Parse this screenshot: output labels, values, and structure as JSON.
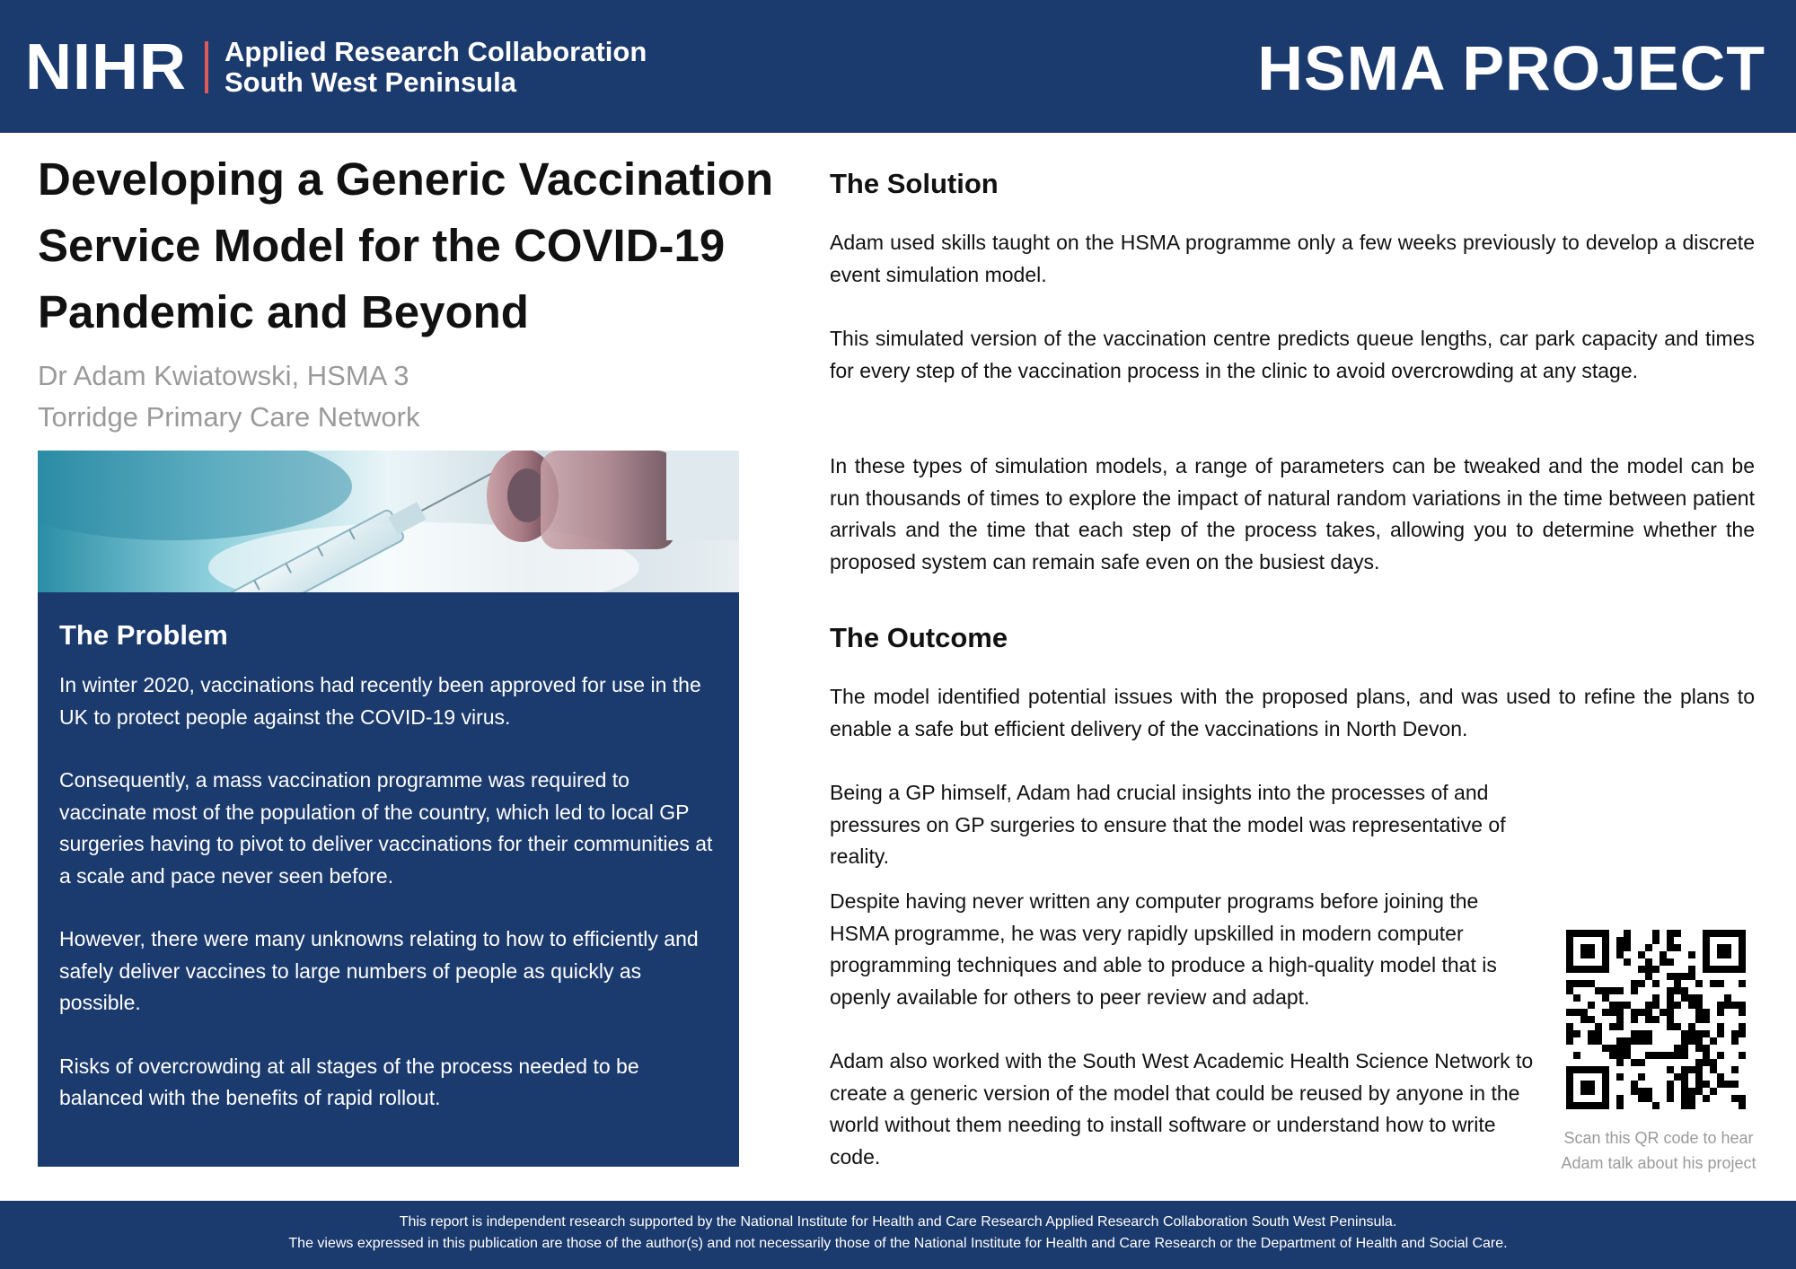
{
  "header": {
    "logo_mark": "NIHR",
    "logo_line1": "Applied Research Collaboration",
    "logo_line2": "South West Peninsula",
    "project_label": "HSMA PROJECT"
  },
  "title": {
    "line1": "Developing a Generic Vaccination",
    "line2": "Service Model for the COVID-19",
    "line3": "Pandemic and Beyond"
  },
  "author": {
    "name": "Dr Adam Kwiatowski, HSMA 3",
    "org": "Torridge Primary Care Network"
  },
  "problem": {
    "heading": "The Problem",
    "paragraphs": [
      "In winter 2020, vaccinations had recently been approved for use in the UK to protect people against the COVID-19 virus.",
      "Consequently, a mass vaccination programme was required to vaccinate most of the population of the country, which led to local GP surgeries having to pivot to deliver vaccinations for their communities at a scale and pace never seen before.",
      "However, there were many unknowns relating to how to efficiently and safely deliver vaccines to large numbers of people as quickly as possible.",
      "Risks of overcrowding at all stages of the process needed to be balanced with the benefits of rapid rollout."
    ]
  },
  "solution": {
    "heading": "The Solution",
    "paragraphs": [
      "Adam used skills taught on the HSMA programme only a few weeks previously to develop a discrete event simulation model.",
      "This simulated version of the vaccination centre predicts queue lengths, car park capacity and times for every step of the vaccination process in the clinic to avoid overcrowding at any stage.",
      "In these types of simulation models, a range of parameters can be tweaked and the model can be run thousands of times to explore the impact of natural random variations in the time between patient arrivals and the time that each step of the process takes, allowing you to determine whether the proposed system can remain safe even on the busiest days."
    ]
  },
  "outcome": {
    "heading": "The Outcome",
    "paragraphs": [
      "The model identified potential issues with the proposed plans, and was used to refine the plans to enable a safe but efficient delivery of the vaccinations in North Devon.",
      "Being a GP himself, Adam had crucial insights into the processes of and pressures on GP surgeries to ensure that the model was representative of reality.",
      "Despite having never written any computer programs before joining the HSMA programme, he was very rapidly upskilled in modern computer programming techniques and able to produce a high-quality model that is openly available for others to peer review and adapt.",
      "Adam also worked with the South West Academic Health Science Network to create a generic version of the model that could be reused by anyone in the world without them needing to install software or understand how to write code."
    ]
  },
  "qr": {
    "caption_line1": "Scan this QR code to hear",
    "caption_line2": "Adam talk about his project"
  },
  "footer": {
    "line1": "This report is independent research supported by the National Institute for Health and Care Research Applied Research Collaboration South West Peninsula.",
    "line2": "The views expressed in this publication are those of the author(s) and not necessarily those of the National Institute for Health and Care Research or the Department of Health and Social Care."
  },
  "colors": {
    "navy": "#1b3a6e",
    "accent_red": "#e05a5a",
    "muted_grey": "#9a9a9a"
  }
}
